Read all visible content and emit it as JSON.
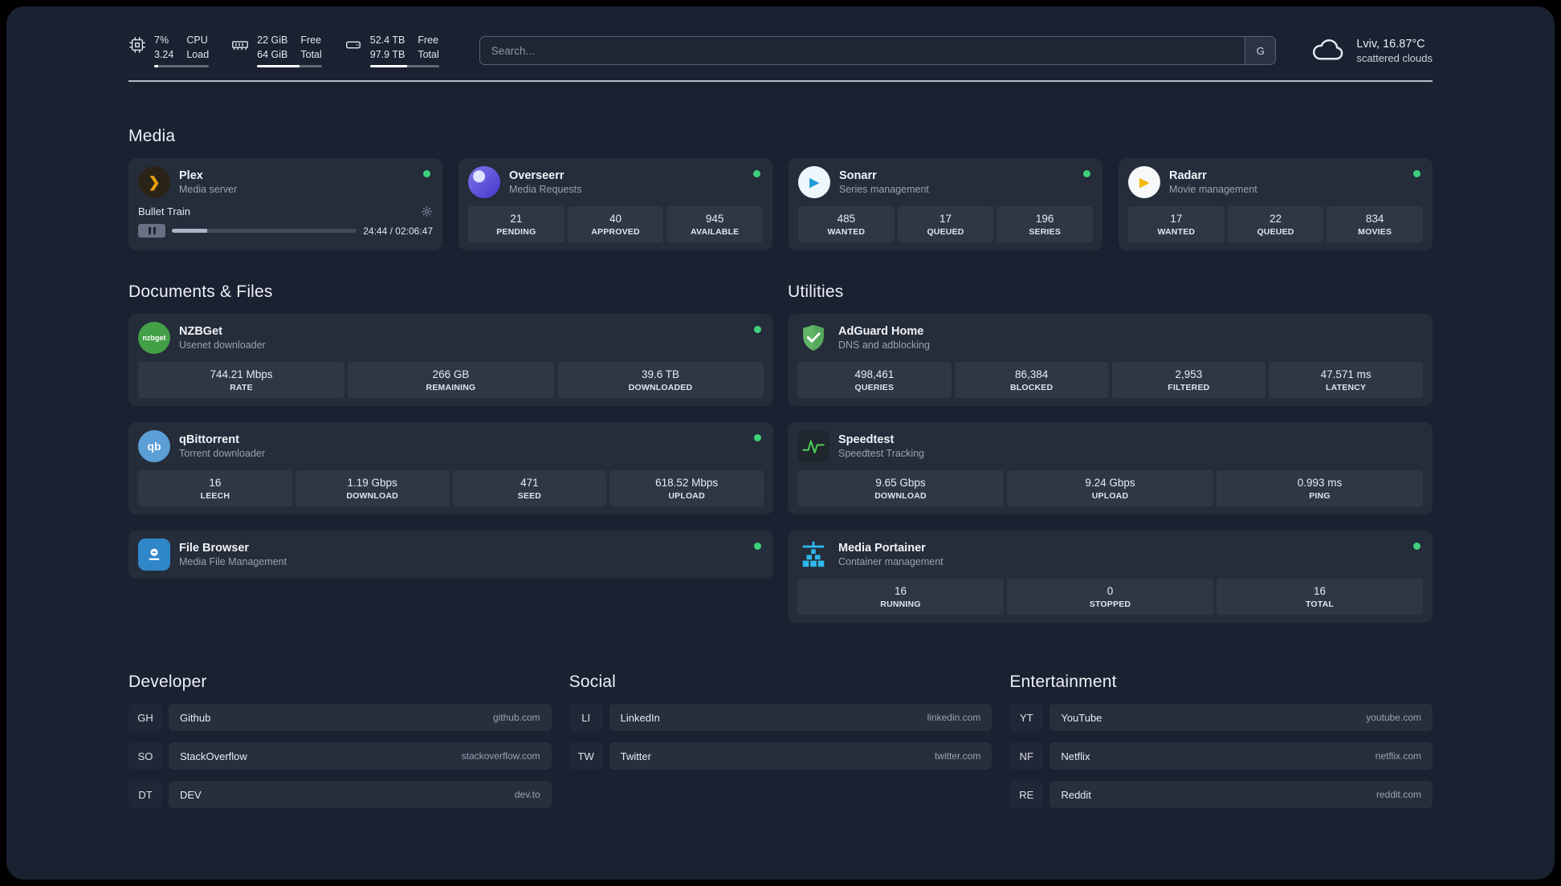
{
  "topbar": {
    "resources": [
      {
        "v1": "7%",
        "v2": "3.24",
        "l1": "CPU",
        "l2": "Load",
        "progress": "7%"
      },
      {
        "v1": "22 GiB",
        "v2": "64 GiB",
        "l1": "Free",
        "l2": "Total",
        "progress": "66%"
      },
      {
        "v1": "52.4 TB",
        "v2": "97.9 TB",
        "l1": "Free",
        "l2": "Total",
        "progress": "54%"
      }
    ],
    "search": {
      "placeholder": "Search...",
      "button_label": "G"
    },
    "weather": {
      "location": "Lviv, 16.87°C",
      "condition": "scattered clouds"
    }
  },
  "media": {
    "title": "Media",
    "services": [
      {
        "name": "Plex",
        "desc": "Media server",
        "status": "online",
        "player": {
          "track": "Bullet Train",
          "time": "24:44 / 02:06:47",
          "progress": "19%"
        }
      },
      {
        "name": "Overseerr",
        "desc": "Media Requests",
        "status": "online",
        "stats": [
          {
            "value": "21",
            "label": "PENDING"
          },
          {
            "value": "40",
            "label": "APPROVED"
          },
          {
            "value": "945",
            "label": "AVAILABLE"
          }
        ]
      },
      {
        "name": "Sonarr",
        "desc": "Series management",
        "status": "online",
        "stats": [
          {
            "value": "485",
            "label": "WANTED"
          },
          {
            "value": "17",
            "label": "QUEUED"
          },
          {
            "value": "196",
            "label": "SERIES"
          }
        ]
      },
      {
        "name": "Radarr",
        "desc": "Movie management",
        "status": "online",
        "stats": [
          {
            "value": "17",
            "label": "WANTED"
          },
          {
            "value": "22",
            "label": "QUEUED"
          },
          {
            "value": "834",
            "label": "MOVIES"
          }
        ]
      }
    ]
  },
  "documents": {
    "title": "Documents & Files",
    "services": [
      {
        "name": "NZBGet",
        "desc": "Usenet downloader",
        "status": "online",
        "icon_label": "nzbget",
        "stats": [
          {
            "value": "744.21 Mbps",
            "label": "RATE"
          },
          {
            "value": "266 GB",
            "label": "REMAINING"
          },
          {
            "value": "39.6 TB",
            "label": "DOWNLOADED"
          }
        ]
      },
      {
        "name": "qBittorrent",
        "desc": "Torrent downloader",
        "status": "online",
        "icon_label": "qb",
        "stats": [
          {
            "value": "16",
            "label": "LEECH"
          },
          {
            "value": "1.19 Gbps",
            "label": "DOWNLOAD"
          },
          {
            "value": "471",
            "label": "SEED"
          },
          {
            "value": "618.52 Mbps",
            "label": "UPLOAD"
          }
        ]
      },
      {
        "name": "File Browser",
        "desc": "Media File Management",
        "status": "online",
        "stats": []
      }
    ]
  },
  "utilities": {
    "title": "Utilities",
    "services": [
      {
        "name": "AdGuard Home",
        "desc": "DNS and adblocking",
        "stats": [
          {
            "value": "498,461",
            "label": "QUERIES"
          },
          {
            "value": "86,384",
            "label": "BLOCKED"
          },
          {
            "value": "2,953",
            "label": "FILTERED"
          },
          {
            "value": "47.571 ms",
            "label": "LATENCY"
          }
        ]
      },
      {
        "name": "Speedtest",
        "desc": "Speedtest Tracking",
        "stats": [
          {
            "value": "9.65 Gbps",
            "label": "DOWNLOAD"
          },
          {
            "value": "9.24 Gbps",
            "label": "UPLOAD"
          },
          {
            "value": "0.993 ms",
            "label": "PING"
          }
        ]
      },
      {
        "name": "Media Portainer",
        "desc": "Container management",
        "status": "online",
        "stats": [
          {
            "value": "16",
            "label": "RUNNING"
          },
          {
            "value": "0",
            "label": "STOPPED"
          },
          {
            "value": "16",
            "label": "TOTAL"
          }
        ]
      }
    ]
  },
  "bookmarks": [
    {
      "title": "Developer",
      "items": [
        {
          "abbr": "GH",
          "name": "Github",
          "url": "github.com"
        },
        {
          "abbr": "SO",
          "name": "StackOverflow",
          "url": "stackoverflow.com"
        },
        {
          "abbr": "DT",
          "name": "DEV",
          "url": "dev.to"
        }
      ]
    },
    {
      "title": "Social",
      "items": [
        {
          "abbr": "LI",
          "name": "LinkedIn",
          "url": "linkedin.com"
        },
        {
          "abbr": "TW",
          "name": "Twitter",
          "url": "twitter.com"
        }
      ]
    },
    {
      "title": "Entertainment",
      "items": [
        {
          "abbr": "YT",
          "name": "YouTube",
          "url": "youtube.com"
        },
        {
          "abbr": "NF",
          "name": "Netflix",
          "url": "netflix.com"
        },
        {
          "abbr": "RE",
          "name": "Reddit",
          "url": "reddit.com"
        }
      ]
    }
  ]
}
